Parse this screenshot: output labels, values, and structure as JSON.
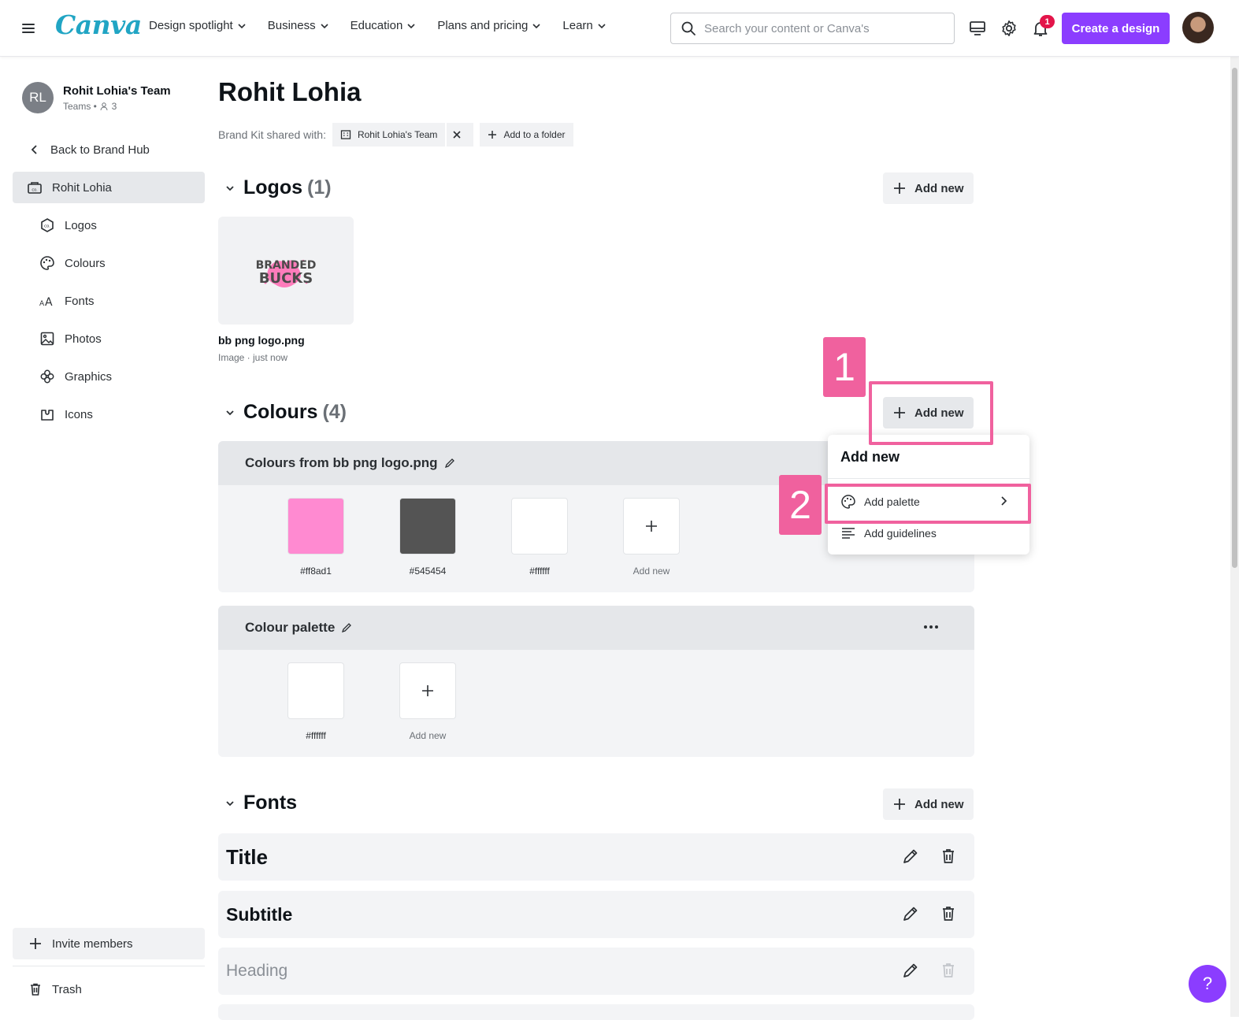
{
  "nav": {
    "logo": "Canva",
    "links": [
      "Design spotlight",
      "Business",
      "Education",
      "Plans and pricing",
      "Learn"
    ],
    "search_placeholder": "Search your content or Canva's",
    "notifications": "1",
    "create_label": "Create a design"
  },
  "sidebar": {
    "team_initials": "RL",
    "team_name": "Rohit Lohia's Team",
    "team_sub": "Teams •",
    "member_count": "3",
    "back_label": "Back to Brand Hub",
    "kit_label": "Rohit Lohia",
    "items": [
      "Logos",
      "Colours",
      "Fonts",
      "Photos",
      "Graphics",
      "Icons"
    ],
    "invite_label": "Invite members",
    "trash_label": "Trash"
  },
  "main": {
    "title": "Rohit Lohia",
    "shared_label": "Brand Kit shared with:",
    "shared_chip": "Rohit Lohia's Team",
    "add_folder": "Add to a folder",
    "add_new": "Add new",
    "logos": {
      "heading": "Logos",
      "count": "(1)",
      "file_name": "bb png logo.png",
      "file_meta": "Image · just now",
      "logo_text_top": "BRANDED",
      "logo_text_bottom": "BUCKS"
    },
    "colours": {
      "heading": "Colours",
      "count": "(4)",
      "palettes": [
        {
          "name": "Colours from bb png logo.png",
          "swatches": [
            {
              "hex": "#ff8ad1",
              "color": "#ff8ad1"
            },
            {
              "hex": "#545454",
              "color": "#545454"
            },
            {
              "hex": "#ffffff",
              "color": "#ffffff"
            }
          ]
        },
        {
          "name": "Colour palette",
          "swatches": [
            {
              "hex": "#ffffff",
              "color": "#ffffff"
            }
          ]
        }
      ]
    },
    "fonts": {
      "heading": "Fonts",
      "rows": [
        "Title",
        "Subtitle",
        "Heading"
      ]
    }
  },
  "dropdown": {
    "title": "Add new",
    "items": [
      "Add palette",
      "Add guidelines"
    ]
  },
  "annotations": [
    "1",
    "2"
  ],
  "help_label": "?",
  "colors": {
    "accent": "#8b3dff",
    "annotation": "#f0619e",
    "canva_logo": "#21a5c4"
  }
}
